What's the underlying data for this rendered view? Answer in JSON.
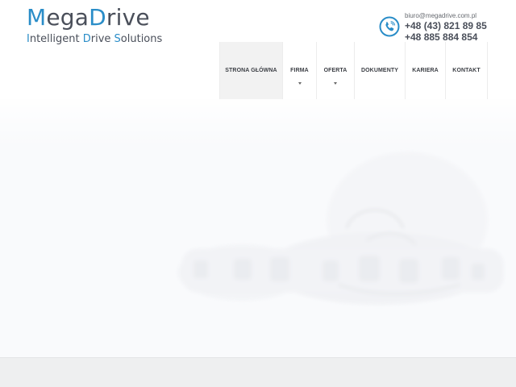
{
  "logo": {
    "main_prefix": "M",
    "main_middle": "ega",
    "main_d": "D",
    "main_rest": "rive",
    "tagline": {
      "i": "I",
      "ntelligent": "ntelligent ",
      "d": "D",
      "rive": "rive ",
      "s": "S",
      "olutions": "olutions"
    }
  },
  "contact": {
    "email": "biuro@megadrive.com.pl",
    "phone1": "+48 (43) 821 89 85",
    "phone2": "+48 885 884 854",
    "icon": "phone-icon"
  },
  "nav": {
    "items": [
      {
        "label": "STRONA GŁÓWNA",
        "active": true,
        "dropdown": false
      },
      {
        "label": "FIRMA",
        "active": false,
        "dropdown": true
      },
      {
        "label": "OFERTA",
        "active": false,
        "dropdown": true
      },
      {
        "label": "DOKUMENTY",
        "active": false,
        "dropdown": false
      },
      {
        "label": "KARIERA",
        "active": false,
        "dropdown": false
      },
      {
        "label": "KONTAKT",
        "active": false,
        "dropdown": false
      }
    ]
  },
  "colors": {
    "brand_blue": "#2a8dc8",
    "brand_gray": "#4a4f5a",
    "nav_active_bg": "#f2f2f2",
    "hero_bg": "#f9fafc",
    "footer_strip": "#eeeff0"
  }
}
